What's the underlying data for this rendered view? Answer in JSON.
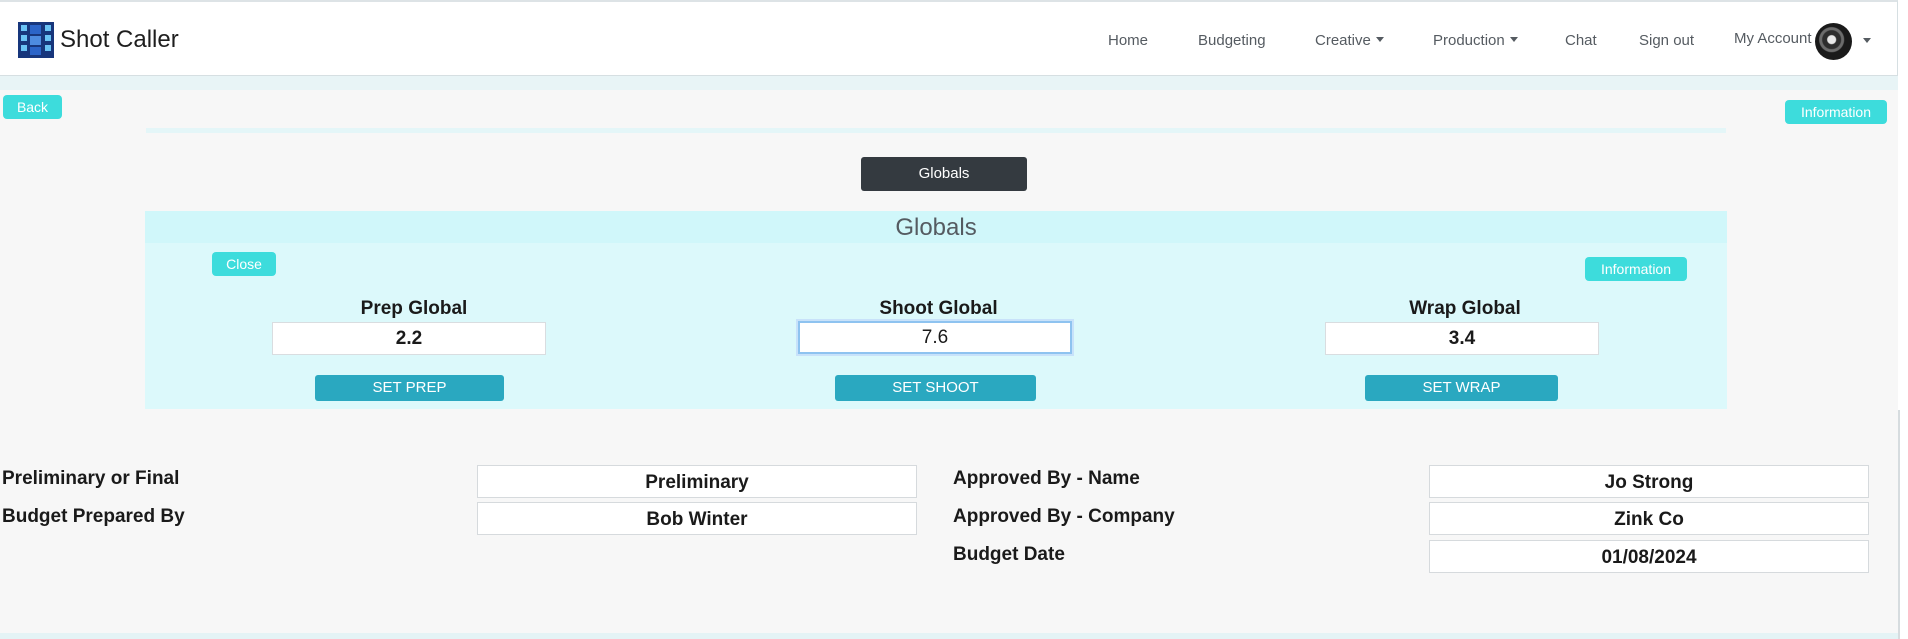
{
  "nav": {
    "brand": "Shot Caller",
    "items": [
      "Home",
      "Budgeting",
      "Creative",
      "Production",
      "Chat",
      "Sign out",
      "My Account"
    ]
  },
  "buttons": {
    "back": "Back",
    "information_top": "Information",
    "globals_toggle": "Globals",
    "close": "Close",
    "information_panel": "Information"
  },
  "globals": {
    "title": "Globals",
    "prep": {
      "label": "Prep Global",
      "value": "2.2",
      "button": "SET PREP"
    },
    "shoot": {
      "label": "Shoot Global",
      "value": "7.6",
      "button": "SET SHOOT"
    },
    "wrap": {
      "label": "Wrap Global",
      "value": "3.4",
      "button": "SET WRAP"
    }
  },
  "details": {
    "prelim_label": "Preliminary or Final",
    "prelim_value": "Preliminary",
    "prepared_label": "Budget Prepared By",
    "prepared_value": "Bob Winter",
    "approved_name_label": "Approved By - Name",
    "approved_name_value": "Jo Strong",
    "approved_company_label": "Approved By - Company",
    "approved_company_value": "Zink Co",
    "date_label": "Budget Date",
    "date_value": "01/08/2024"
  },
  "colors": {
    "accent_cyan": "#3ddcdc",
    "teal_button": "#2aa8c0",
    "dark_button": "#343a40",
    "panel_bg": "#dcf9fb"
  }
}
